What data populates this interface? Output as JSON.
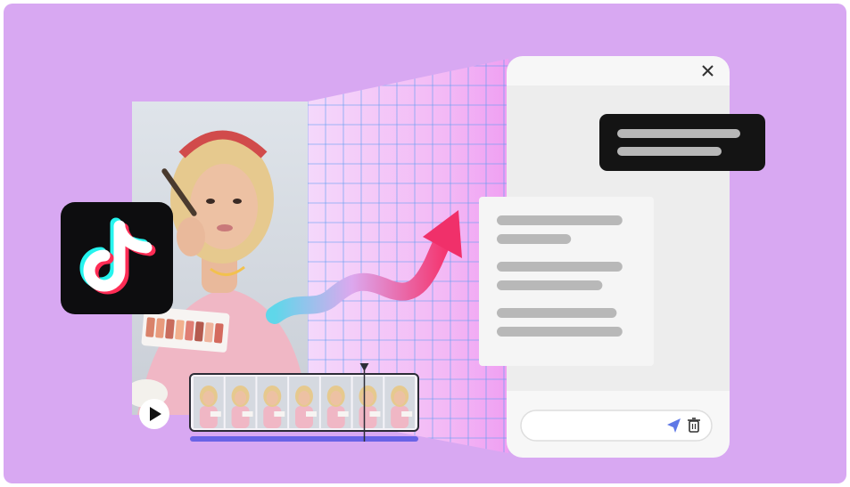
{
  "colors": {
    "background": "#d8a8f2",
    "grid_line": "#5b9cf0",
    "tiktok_black": "#0d0d0f",
    "tiktok_cyan": "#25f4ee",
    "tiktok_red": "#fe2c55",
    "timeline_bar": "#6a63e6",
    "send_icon": "#5f78e6",
    "chat_bubble_dark": "#141414",
    "placeholder_line": "#b8b8b8"
  },
  "icons": {
    "close": "close-icon",
    "play": "play-icon",
    "send": "send-icon",
    "delete": "trash-icon",
    "app_logo": "tiktok-logo-icon",
    "growth": "growth-arrow-icon"
  },
  "timeline": {
    "frame_count": 7,
    "playhead_fraction": 0.77
  },
  "chat_panel": {
    "input_value": "",
    "incoming_lines": [
      0.92,
      0.78
    ],
    "reply_lines": [
      0.88,
      0.52,
      0.88,
      0.74,
      0.84,
      0.88
    ]
  }
}
